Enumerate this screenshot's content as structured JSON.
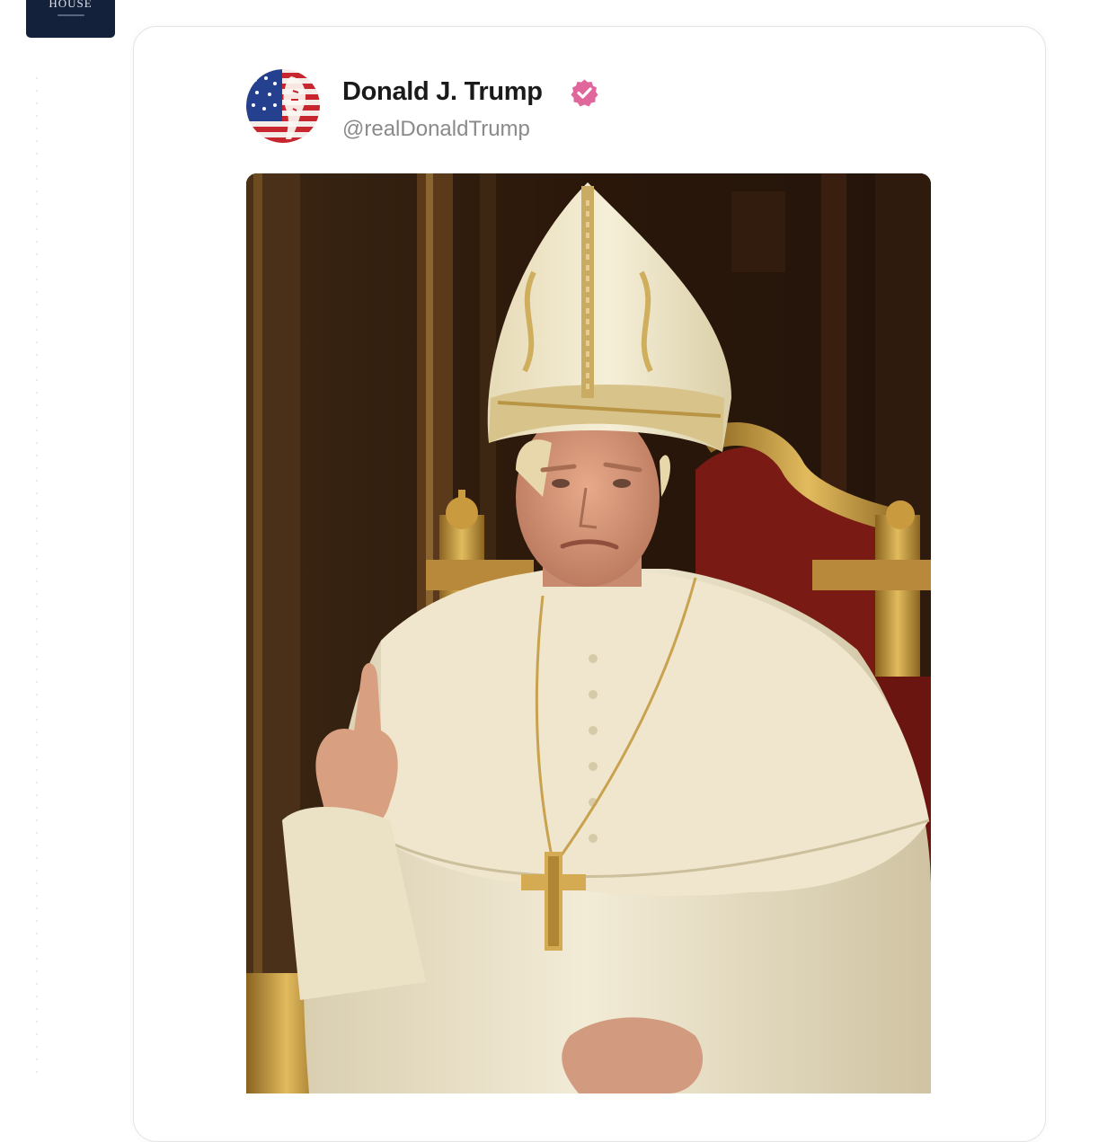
{
  "app_icon": {
    "text": "HOUSE",
    "icon": "app-logo-icon"
  },
  "post": {
    "author": {
      "display_name": "Donald J. Trump",
      "handle": "@realDonaldTrump",
      "verified": true,
      "avatar_icon": "flag-avatar-icon",
      "verified_icon": "verified-badge-icon"
    },
    "image_icon": "post-image-icon"
  },
  "colors": {
    "app_icon_bg": "#14213b",
    "verified_badge": "#e0679b",
    "name_text": "#1a1a1a",
    "handle_text": "#8a8a8a",
    "card_border": "#e4e4e4"
  }
}
